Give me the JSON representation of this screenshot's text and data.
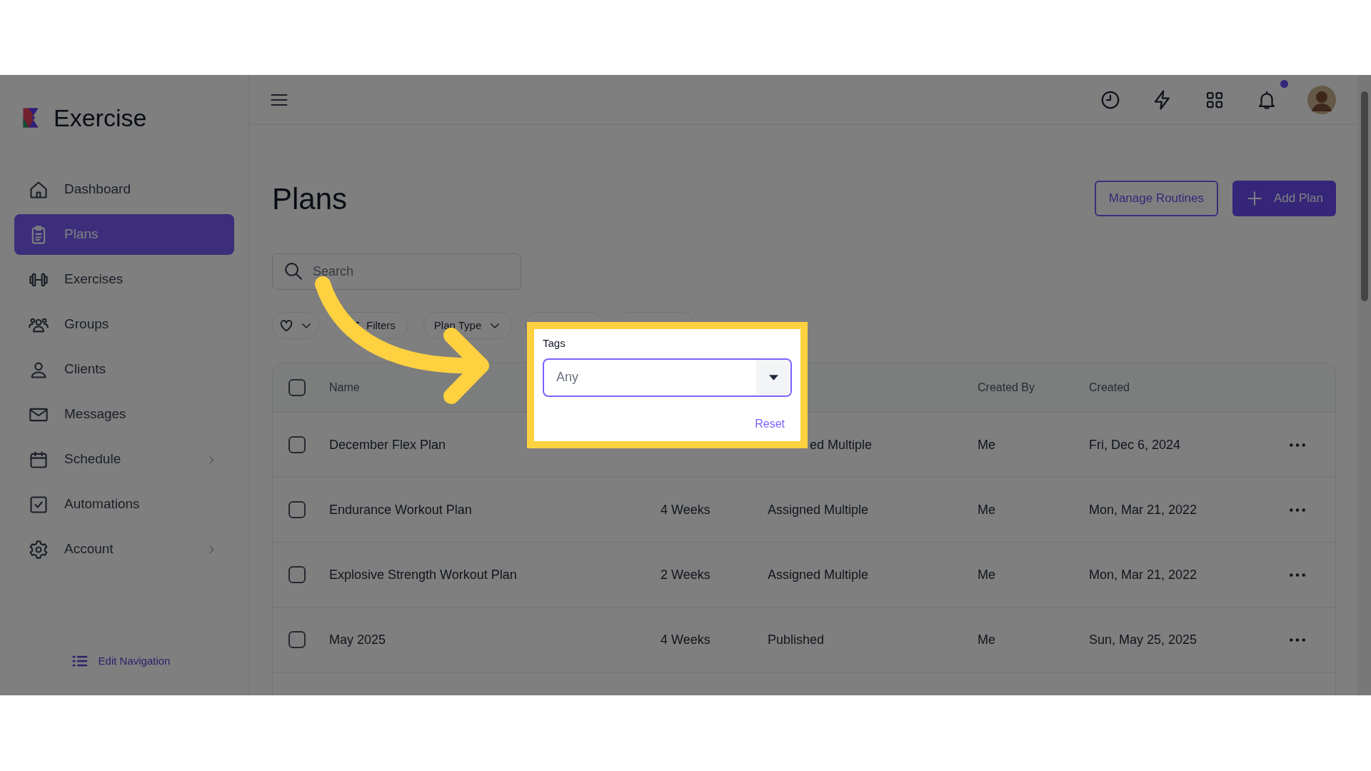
{
  "app": {
    "name": "Exercise"
  },
  "sidebar": {
    "items": [
      {
        "label": "Dashboard",
        "selected": false,
        "submenu": false
      },
      {
        "label": "Plans",
        "selected": true,
        "submenu": false
      },
      {
        "label": "Exercises",
        "selected": false,
        "submenu": false
      },
      {
        "label": "Groups",
        "selected": false,
        "submenu": false
      },
      {
        "label": "Clients",
        "selected": false,
        "submenu": false
      },
      {
        "label": "Messages",
        "selected": false,
        "submenu": false
      },
      {
        "label": "Schedule",
        "selected": false,
        "submenu": true
      },
      {
        "label": "Automations",
        "selected": false,
        "submenu": false
      },
      {
        "label": "Account",
        "selected": false,
        "submenu": true
      }
    ],
    "edit_navigation": "Edit Navigation"
  },
  "topbar": {
    "notifications_unread": true
  },
  "page": {
    "title": "Plans",
    "buttons": [
      {
        "label": "Manage Routines",
        "kind": "outline"
      },
      {
        "label": "Add Plan",
        "kind": "primary"
      }
    ]
  },
  "search": {
    "placeholder": "Search"
  },
  "filters": [
    {
      "kind": "favorite"
    },
    {
      "kind": "filters",
      "label": "Filters"
    },
    {
      "kind": "dropdown",
      "label": "Plan Type"
    },
    {
      "kind": "covered"
    },
    {
      "kind": "covered"
    }
  ],
  "table": {
    "all_selected": false,
    "columns": {
      "name": "Name",
      "created_by": "Created By",
      "created": "Created"
    },
    "rows": [
      {
        "selected": false,
        "name": "December Flex Plan",
        "status": "ed Multiple",
        "created_by": "Me",
        "created": "Fri, Dec 6, 2024"
      },
      {
        "selected": false,
        "name": "Endurance Workout Plan",
        "duration": "4 Weeks",
        "status": "Assigned Multiple",
        "created_by": "Me",
        "created": "Mon, Mar 21, 2022"
      },
      {
        "selected": false,
        "name": "Explosive Strength Workout Plan",
        "duration": "2 Weeks",
        "status": "Assigned Multiple",
        "created_by": "Me",
        "created": "Mon, Mar 21, 2022"
      },
      {
        "selected": false,
        "name": "May 2025",
        "duration": "4 Weeks",
        "status": "Published",
        "created_by": "Me",
        "created": "Sun, May 25, 2025"
      }
    ]
  },
  "tags_popup": {
    "label": "Tags",
    "value": "Any",
    "reset": "Reset"
  }
}
